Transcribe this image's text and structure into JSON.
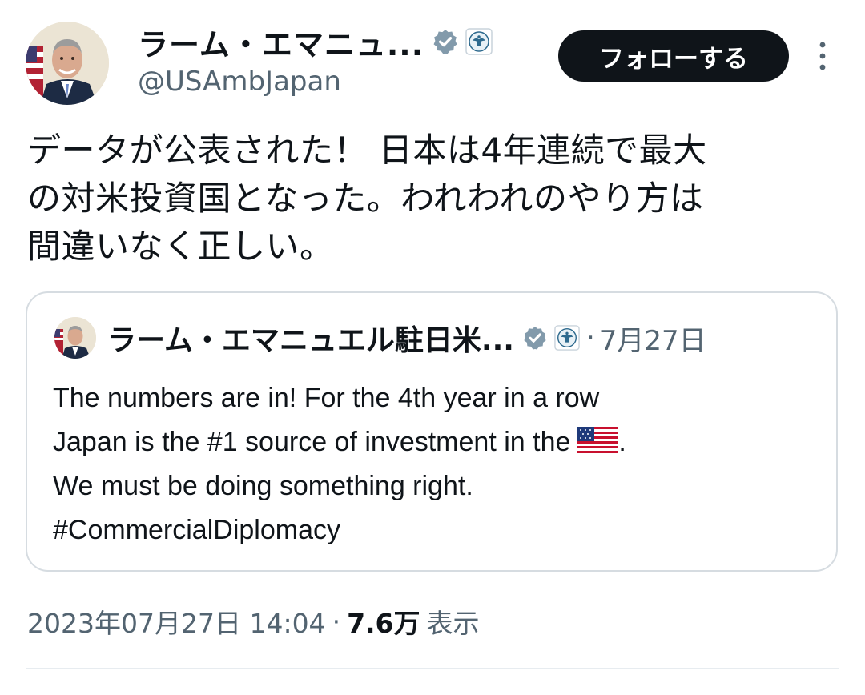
{
  "author": {
    "display_name": "ラーム・エマニュ...",
    "handle": "@USAmbJapan",
    "avatar_icon": "profile-photo",
    "verified_icon": "verified-badge-icon",
    "affiliation_icon": "us-state-department-seal-icon"
  },
  "follow_button": {
    "label": "フォローする"
  },
  "more_menu": {
    "icon": "vertical-ellipsis-icon"
  },
  "tweet": {
    "text": "データが公表された！ 日本は4年連続で最大\nの対米投資国となった。われわれのやり方は\n間違いなく正しい。"
  },
  "quoted_tweet": {
    "display_name": "ラーム・エマニュエル駐日米...",
    "separator": "·",
    "date": "7月27日",
    "lines": [
      "The numbers are in! For the 4th year in a row",
      "Japan is the #1 source of investment in the",
      "We must be doing something right.",
      "#CommercialDiplomacy"
    ],
    "line2_suffix": ".",
    "flag_icon": "us-flag-emoji"
  },
  "meta": {
    "timestamp": "2023年07月27日 14:04",
    "separator": "·",
    "views_count": "7.6万",
    "views_label": "表示"
  },
  "colors": {
    "text_primary": "#0f1419",
    "text_secondary": "#536471",
    "verified_gray": "#829aab",
    "button_bg": "#0f1419",
    "border": "#d6dce1"
  }
}
